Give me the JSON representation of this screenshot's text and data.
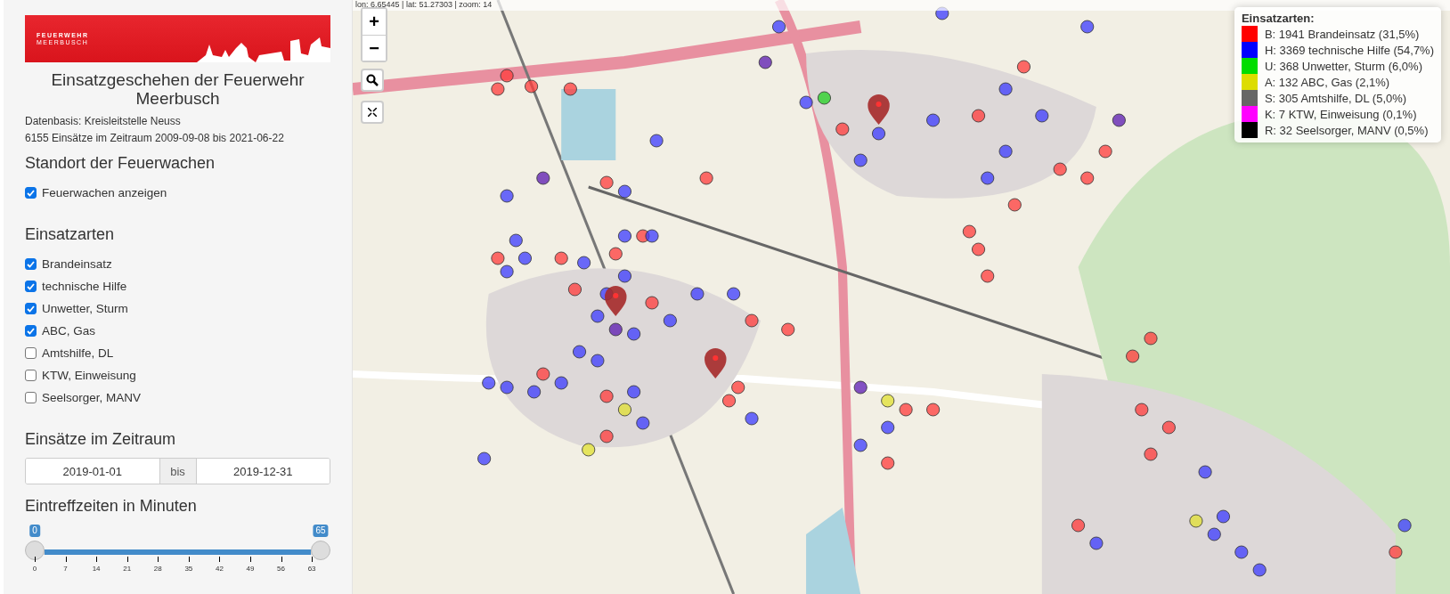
{
  "sidebar": {
    "logo": {
      "line_1": "FEUERWEHR",
      "line_2": "MEERBUSCH"
    },
    "title": "Einsatzgeschehen der Feuerwehr Meerbusch",
    "info": [
      "Datenbasis: Kreisleitstelle Neuss",
      "6155 Einsätze im Zeitraum 2009-09-08 bis 2021-06-22"
    ],
    "stations": {
      "heading": "Standort der Feuerwachen",
      "options": [
        {
          "label": "Feuerwachen anzeigen",
          "checked": true
        }
      ]
    },
    "types": {
      "heading": "Einsatzarten",
      "options": [
        {
          "label": "Brandeinsatz",
          "checked": true
        },
        {
          "label": "technische Hilfe",
          "checked": true
        },
        {
          "label": "Unwetter, Sturm",
          "checked": true
        },
        {
          "label": "ABC, Gas",
          "checked": true
        },
        {
          "label": "Amtshilfe, DL",
          "checked": false
        },
        {
          "label": "KTW, Einweisung",
          "checked": false
        },
        {
          "label": "Seelsorger, MANV",
          "checked": false
        }
      ]
    },
    "period": {
      "heading": "Einsätze im Zeitraum",
      "start": "2019-01-01",
      "separator": "bis",
      "end": "2019-12-31"
    },
    "arrival": {
      "heading": "Eintreffzeiten in Minuten",
      "handles": [
        {
          "label": "0",
          "level": 0
        },
        {
          "label": "65",
          "level": 1
        }
      ],
      "ticks": [
        "0",
        "7",
        "14",
        "21",
        "28",
        "35",
        "42",
        "49",
        "56",
        "63"
      ]
    }
  },
  "map": {
    "coordinates": "lon: 6.65445 | lat: 51.27303 | zoom: 14",
    "zoom_in": "+",
    "zoom_out": "−",
    "legend": {
      "title": "Einsatzarten:",
      "items": [
        {
          "label": "B: 1941 Brandeinsatz (31,5%)",
          "color": "#ff0000"
        },
        {
          "label": "H: 3369 technische Hilfe (54,7%)",
          "color": "#0000ff"
        },
        {
          "label": "U: 368 Unwetter, Sturm (6,0%)",
          "color": "#00dd00"
        },
        {
          "label": "A: 132 ABC, Gas (2,1%)",
          "color": "#dddd00"
        },
        {
          "label": "S: 305 Amtshilfe, DL (5,0%)",
          "color": "#666666"
        },
        {
          "label": "K: 7 KTW, Einweisung (0,1%)",
          "color": "#ff00ff"
        },
        {
          "label": "R: 32 Seelsorger, MANV (0,5%)",
          "color": "#000000"
        }
      ]
    }
  }
}
